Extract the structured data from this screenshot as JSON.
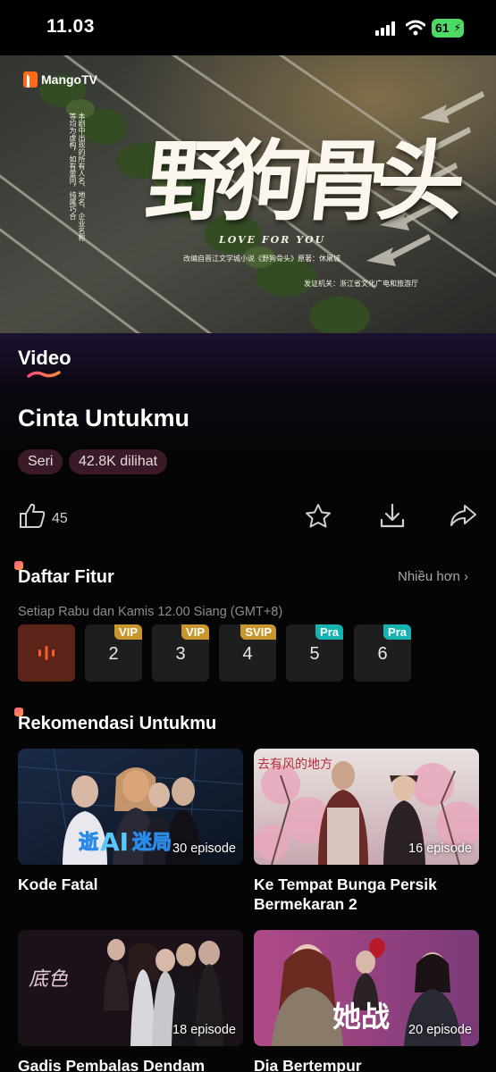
{
  "status": {
    "time": "11.03",
    "battery": "61"
  },
  "hero": {
    "logo": "MangoTV",
    "calligraphy": "野狗骨头",
    "english": "LOVE FOR YOU",
    "adaptation": "改编自晋江文学城小说《野狗骨头》原著：休屠城",
    "issuer": "发证机关：浙江省文化广电和旅游厅",
    "vertical_note": "本剧中出现的所有人名、地名、企业名称等均为虚构，如有雷同，纯属巧合"
  },
  "tabs": {
    "active": "Video"
  },
  "show": {
    "title": "Cinta Untukmu",
    "type_pill": "Seri",
    "views_pill": "42.8K dilihat",
    "like_count": "45"
  },
  "episodes_section": {
    "heading": "Daftar Fitur",
    "more": "Nhiều hơn",
    "schedule": "Setiap Rabu dan Kamis 12.00 Siang (GMT+8)",
    "episodes": [
      {
        "num": "",
        "badge": "",
        "state": "playing"
      },
      {
        "num": "2",
        "badge": "VIP",
        "badge_color": "#c9962e"
      },
      {
        "num": "3",
        "badge": "VIP",
        "badge_color": "#c9962e"
      },
      {
        "num": "4",
        "badge": "SVIP",
        "badge_color": "#c9962e"
      },
      {
        "num": "5",
        "badge": "Pra",
        "badge_color": "#17b3b3"
      },
      {
        "num": "6",
        "badge": "Pra",
        "badge_color": "#17b3b3"
      }
    ]
  },
  "recommend": {
    "heading": "Rekomendasi Untukmu",
    "items": [
      {
        "title": "Kode Fatal",
        "episodes": "30 episode",
        "logo_text": "逝AI爱迷局"
      },
      {
        "title": "Ke Tempat Bunga Persik Bermekaran 2",
        "episodes": "16 episode",
        "logo_text": "去有风的地方"
      },
      {
        "title": "Gadis Pembalas Dendam",
        "episodes": "18 episode",
        "logo_text": "底色"
      },
      {
        "title": "Dia Bertempur",
        "episodes": "20 episode",
        "logo_text": "她战"
      }
    ]
  },
  "colors": {
    "accent": "#ff5a8a",
    "pill_bg": "#3a1a28",
    "vip": "#c9962e",
    "pra": "#17b3b3"
  }
}
